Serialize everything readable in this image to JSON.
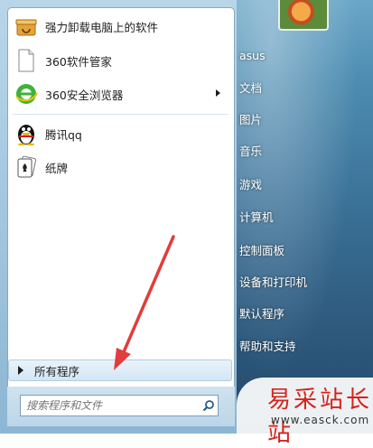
{
  "start_menu": {
    "programs": [
      {
        "label": "强力卸载电脑上的软件",
        "icon": "uninstall-box-icon",
        "has_submenu": false
      },
      {
        "label": "360软件管家",
        "icon": "document-icon",
        "has_submenu": false
      },
      {
        "label": "360安全浏览器",
        "icon": "360-browser-icon",
        "has_submenu": true
      },
      {
        "label": "腾讯qq",
        "icon": "qq-penguin-icon",
        "has_submenu": false
      },
      {
        "label": "纸牌",
        "icon": "solitaire-cards-icon",
        "has_submenu": false
      }
    ],
    "all_programs_label": "所有程序",
    "search_placeholder": "搜索程序和文件"
  },
  "right_pane": {
    "items": [
      "asus",
      "文档",
      "图片",
      "音乐",
      "游戏",
      "计算机",
      "控制面板",
      "设备和打印机",
      "默认程序",
      "帮助和支持"
    ]
  },
  "watermark": {
    "title": "易采站长站",
    "url": "www.easck.com"
  },
  "colors": {
    "annotation_arrow": "#e23c3c",
    "aero_blue": "#3c7399"
  }
}
